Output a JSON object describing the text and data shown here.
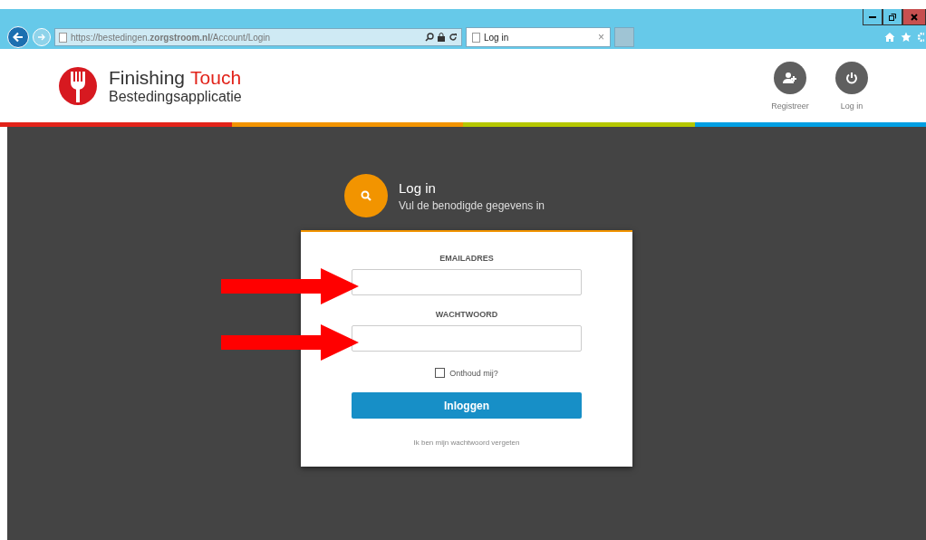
{
  "browser": {
    "url": "https://bestedingen.**zorgstroom.nl**/Account/Login",
    "tab": {
      "title": "Log in",
      "close": "×"
    }
  },
  "header": {
    "brand": {
      "name": "Finishing",
      "accent": "Touch",
      "subtitle": "Bestedingsapplicatie"
    },
    "actions": [
      {
        "kind": "register",
        "label": "Registreer"
      },
      {
        "kind": "login",
        "label": "Log in"
      }
    ]
  },
  "login": {
    "title": "Log in",
    "subtitle": "Vul de benodigde gegevens in",
    "fields": [
      {
        "label": "EMAILADRES"
      },
      {
        "label": "WACHTWOORD"
      }
    ],
    "remember": {
      "label": "Onthoud mij?",
      "checked": false
    },
    "submit": "Inloggen",
    "forgot": "Ik ben mijn wachtwoord vergeten"
  }
}
